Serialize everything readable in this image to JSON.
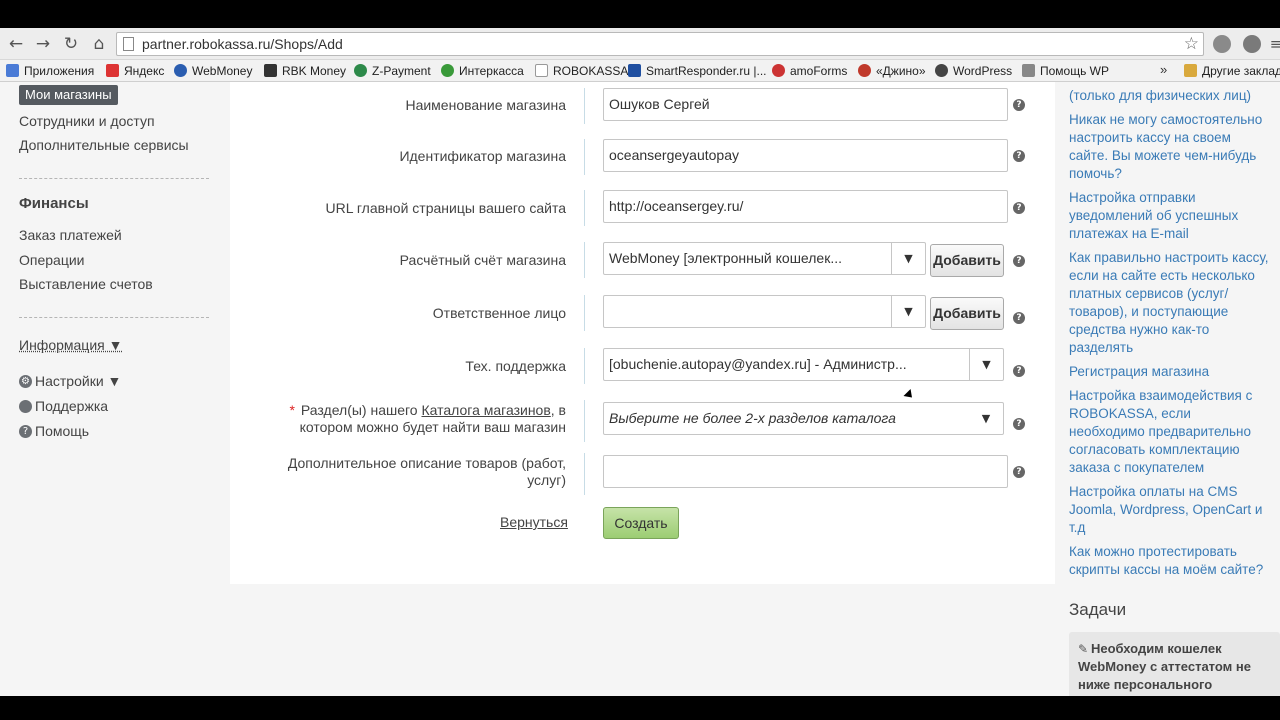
{
  "browser": {
    "url": "partner.robokassa.ru/Shops/Add",
    "bookmarks": [
      {
        "label": "Приложения",
        "color": "#4a7bd6"
      },
      {
        "label": "Яндекс",
        "color": "#d33"
      },
      {
        "label": "WebMoney",
        "color": "#2a5db0"
      },
      {
        "label": "RBK Money",
        "color": "#333"
      },
      {
        "label": "Z-Payment",
        "color": "#2d8a4a"
      },
      {
        "label": "Интеркасса",
        "color": "#3a9a3a"
      },
      {
        "label": "ROBOKASSA",
        "color": "#999"
      },
      {
        "label": "SmartResponder.ru |...",
        "color": "#1f4fa0"
      },
      {
        "label": "amoForms",
        "color": "#c33"
      },
      {
        "label": "«Джино»",
        "color": "#c0392b"
      },
      {
        "label": "WordPress",
        "color": "#444"
      },
      {
        "label": "Помощь WP",
        "color": "#888"
      },
      {
        "label": "»",
        "color": ""
      },
      {
        "label": "Другие заклад",
        "color": "#d9a93d"
      }
    ]
  },
  "sidebar": {
    "active": "Мои магазины",
    "links_top": [
      "Сотрудники и доступ",
      "Дополнительные сервисы"
    ],
    "finance_heading": "Финансы",
    "finance_links": [
      "Заказ платежей",
      "Операции",
      "Выставление счетов"
    ],
    "info": "Информация ▼",
    "settings": "Настройки ▼",
    "support": "Поддержка",
    "help": "Помощь"
  },
  "form": {
    "fields": [
      {
        "label": "Наименование магазина",
        "value": "Ошуков Сергей"
      },
      {
        "label": "Идентификатор магазина",
        "value": "oceansergeyautopay"
      },
      {
        "label": "URL главной страницы вашего сайта",
        "value": "http://oceansergey.ru/"
      },
      {
        "label": "Расчётный счёт магазина",
        "value": "WebMoney [электронный кошелек..."
      },
      {
        "label": "Ответственное лицо",
        "value": ""
      },
      {
        "label": "Тех. поддержка",
        "value": "[obuchenie.autopay@yandex.ru] - Администр..."
      },
      {
        "label_pre": "Раздел(ы) нашего ",
        "label_link": "Каталога магазинов",
        "label_post": ", в котором можно будет найти ваш магазин",
        "value": "Выберите не более 2-х разделов каталога"
      },
      {
        "label": "Дополнительное описание товаров (работ, услуг)",
        "value": ""
      }
    ],
    "add_label": "Добавить",
    "back_label": "Вернуться",
    "create_label": "Создать"
  },
  "right": {
    "links": [
      "(только для физических лиц)",
      "Никак не могу самостоятельно настроить кассу на своем сайте. Вы можете чем-нибудь помочь?",
      "Настройка отправки уведомлений об успешных платежах на E-mail",
      "Как правильно настроить кассу, если на сайте есть несколько платных сервисов (услуг/товаров), и поступающие средства нужно как-то разделять",
      "Регистрация магазина",
      "Настройка взаимодействия с ROBOKASSA, если необходимо предварительно согласовать комплектацию заказа с покупателем",
      "Настройка оплаты на CMS Joomla, Wordpress, OpenCart и т.д",
      "Как можно протестировать скрипты кассы на моём сайте?"
    ],
    "tasks_heading": "Задачи",
    "task": "Необходим кошелек WebMoney с аттестатом не ниже персонального"
  }
}
